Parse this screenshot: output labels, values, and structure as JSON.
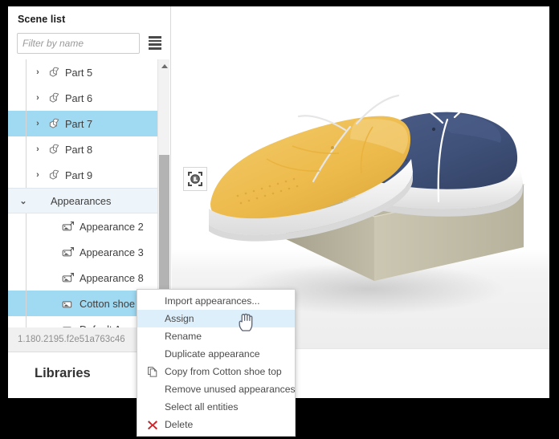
{
  "panel": {
    "title": "Scene list",
    "filter_placeholder": "Filter by name",
    "filter_value": "",
    "list_view_icon": "list-view-icon",
    "version": "1.180.2195.f2e51a763c46",
    "libraries_title": "Libraries"
  },
  "tree": {
    "rows": [
      {
        "label": "Part 5",
        "level": 1,
        "caret": "›",
        "icon": "part-icon",
        "state": "normal"
      },
      {
        "label": "Part 6",
        "level": 1,
        "caret": "›",
        "icon": "part-icon",
        "state": "normal"
      },
      {
        "label": "Part 7",
        "level": 1,
        "caret": "›",
        "icon": "part-icon",
        "state": "selected"
      },
      {
        "label": "Part 8",
        "level": 1,
        "caret": "›",
        "icon": "part-icon",
        "state": "normal"
      },
      {
        "label": "Part 9",
        "level": 1,
        "caret": "›",
        "icon": "part-icon",
        "state": "normal"
      },
      {
        "label": "Appearances",
        "level": 0,
        "caret": "⌄",
        "icon": "none",
        "state": "group"
      },
      {
        "label": "Appearance 2",
        "level": 2,
        "caret": "",
        "icon": "appearance-linked-icon",
        "state": "normal"
      },
      {
        "label": "Appearance 3",
        "level": 2,
        "caret": "",
        "icon": "appearance-linked-icon",
        "state": "normal"
      },
      {
        "label": "Appearance 8",
        "level": 2,
        "caret": "",
        "icon": "appearance-linked-icon",
        "state": "normal"
      },
      {
        "label": "Cotton shoe top",
        "level": 2,
        "caret": "",
        "icon": "appearance-icon",
        "state": "selected"
      },
      {
        "label": "Default Appearance",
        "level": 2,
        "caret": "",
        "icon": "appearance-icon",
        "state": "normal"
      }
    ]
  },
  "scrollbar": {
    "up_arrow_icon": "scroll-up-arrow-icon"
  },
  "viewport": {
    "fit_tool_icon": "zoom-to-fit-icon",
    "model_name": "two sneakers on a shoe box",
    "colors": {
      "shoe_yellow": "#edbb4c",
      "shoe_navy": "#3f5179",
      "sole_white": "#f7f7f7",
      "box_tan": "#c7c3ae",
      "background": "#ffffff"
    }
  },
  "context_menu": {
    "items": [
      {
        "label": "Import appearances...",
        "icon": "none",
        "highlight": false
      },
      {
        "label": "Assign",
        "icon": "none",
        "highlight": true
      },
      {
        "label": "Rename",
        "icon": "none",
        "highlight": false
      },
      {
        "label": "Duplicate appearance",
        "icon": "none",
        "highlight": false
      },
      {
        "label": "Copy from Cotton shoe top",
        "icon": "copy-icon",
        "highlight": false
      },
      {
        "label": "Remove unused appearances",
        "icon": "none",
        "highlight": false
      },
      {
        "label": "Select all entities",
        "icon": "none",
        "highlight": false
      },
      {
        "label": "Delete",
        "icon": "delete-icon",
        "highlight": false
      }
    ],
    "delete_icon_color": "#cc2229"
  },
  "cursor": {
    "type": "pointing-hand-cursor"
  }
}
